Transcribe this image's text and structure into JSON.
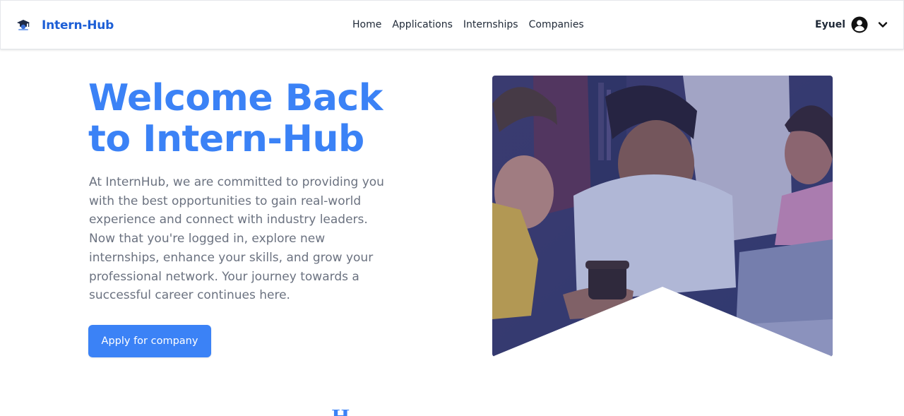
{
  "navbar": {
    "brand_name": "Intern-Hub",
    "logo_icon": "graduate-logo-icon",
    "links": [
      {
        "label": "Home"
      },
      {
        "label": "Applications"
      },
      {
        "label": "Internships"
      },
      {
        "label": "Companies"
      }
    ],
    "user": {
      "name": "Eyuel",
      "avatar_icon": "user-circle-icon",
      "dropdown_icon": "chevron-down-icon"
    }
  },
  "hero": {
    "title_line1": "Welcome Back",
    "title_line2": "to Intern-Hub",
    "description": "At InternHub, we are committed to providing you with the best opportunities to gain real-world experience and connect with industry leaders. Now that you're logged in, explore new internships, enhance your skills, and grow your professional network. Your journey towards a successful career continues here.",
    "cta_label": "Apply for company",
    "image_alt": "Students smiling while looking at a laptop"
  },
  "next_section": {
    "title_partial": "H"
  },
  "colors": {
    "primary": "#3b82f6",
    "brand": "#1d5fd6",
    "body_text": "#6b7280",
    "image_overlay": "#3d4d9a"
  }
}
